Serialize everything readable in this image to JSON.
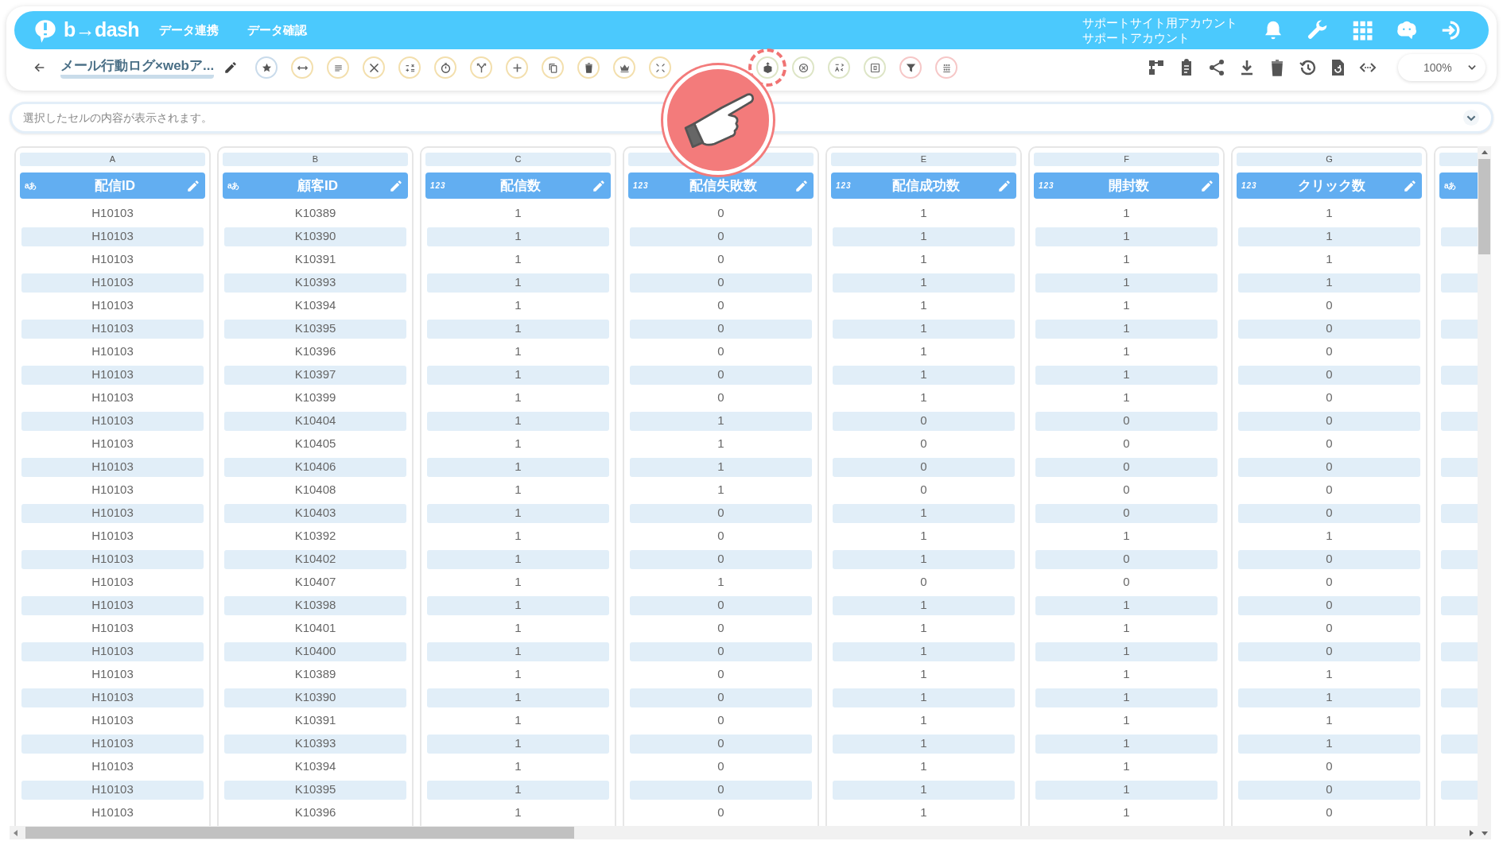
{
  "header": {
    "logo": "b→dash",
    "nav": [
      "データ連携",
      "データ確認"
    ],
    "account": {
      "line_1": "サポートサイト用アカウント",
      "line_2": "サポートアカウント"
    }
  },
  "toolbar": {
    "title": "メール行動ログ×webア...",
    "zoom": "100%"
  },
  "formula_bar": {
    "placeholder": "選択したセルの内容が表示されます。"
  },
  "table": {
    "columns": [
      {
        "letter": "A",
        "kind": "text",
        "type_label": "aあ",
        "name": "配信ID",
        "cells": [
          "H10103",
          "H10103",
          "H10103",
          "H10103",
          "H10103",
          "H10103",
          "H10103",
          "H10103",
          "H10103",
          "H10103",
          "H10103",
          "H10103",
          "H10103",
          "H10103",
          "H10103",
          "H10103",
          "H10103",
          "H10103",
          "H10103",
          "H10103",
          "H10103",
          "H10103",
          "H10103",
          "H10103",
          "H10103",
          "H10103",
          "H10103"
        ]
      },
      {
        "letter": "B",
        "kind": "text",
        "type_label": "aあ",
        "name": "顧客ID",
        "cells": [
          "K10389",
          "K10390",
          "K10391",
          "K10393",
          "K10394",
          "K10395",
          "K10396",
          "K10397",
          "K10399",
          "K10404",
          "K10405",
          "K10406",
          "K10408",
          "K10403",
          "K10392",
          "K10402",
          "K10407",
          "K10398",
          "K10401",
          "K10400",
          "K10389",
          "K10390",
          "K10391",
          "K10393",
          "K10394",
          "K10395",
          "K10396"
        ]
      },
      {
        "letter": "C",
        "kind": "number",
        "type_label": "123",
        "name": "配信数",
        "cells": [
          "1",
          "1",
          "1",
          "1",
          "1",
          "1",
          "1",
          "1",
          "1",
          "1",
          "1",
          "1",
          "1",
          "1",
          "1",
          "1",
          "1",
          "1",
          "1",
          "1",
          "1",
          "1",
          "1",
          "1",
          "1",
          "1",
          "1"
        ]
      },
      {
        "kind": "number",
        "type_label": "123",
        "name": "配信失敗数",
        "cells": [
          "0",
          "0",
          "0",
          "0",
          "0",
          "0",
          "0",
          "0",
          "0",
          "1",
          "1",
          "1",
          "1",
          "0",
          "0",
          "0",
          "1",
          "0",
          "0",
          "0",
          "0",
          "0",
          "0",
          "0",
          "0",
          "0",
          "0"
        ]
      },
      {
        "letter": "E",
        "kind": "number",
        "type_label": "123",
        "name": "配信成功数",
        "cells": [
          "1",
          "1",
          "1",
          "1",
          "1",
          "1",
          "1",
          "1",
          "1",
          "0",
          "0",
          "0",
          "0",
          "1",
          "1",
          "1",
          "0",
          "1",
          "1",
          "1",
          "1",
          "1",
          "1",
          "1",
          "1",
          "1",
          "1"
        ]
      },
      {
        "letter": "F",
        "kind": "number",
        "type_label": "123",
        "name": "開封数",
        "cells": [
          "1",
          "1",
          "1",
          "1",
          "1",
          "1",
          "1",
          "1",
          "1",
          "0",
          "0",
          "0",
          "0",
          "0",
          "1",
          "0",
          "0",
          "1",
          "1",
          "1",
          "1",
          "1",
          "1",
          "1",
          "1",
          "1",
          "1"
        ]
      },
      {
        "letter": "G",
        "kind": "number",
        "type_label": "123",
        "name": "クリック数",
        "cells": [
          "1",
          "1",
          "1",
          "1",
          "0",
          "0",
          "0",
          "0",
          "0",
          "0",
          "0",
          "0",
          "0",
          "0",
          "1",
          "0",
          "0",
          "0",
          "0",
          "0",
          "1",
          "1",
          "1",
          "1",
          "0",
          "0",
          "0"
        ]
      },
      {
        "kind": "text",
        "type_label": "aあ"
      }
    ]
  }
}
